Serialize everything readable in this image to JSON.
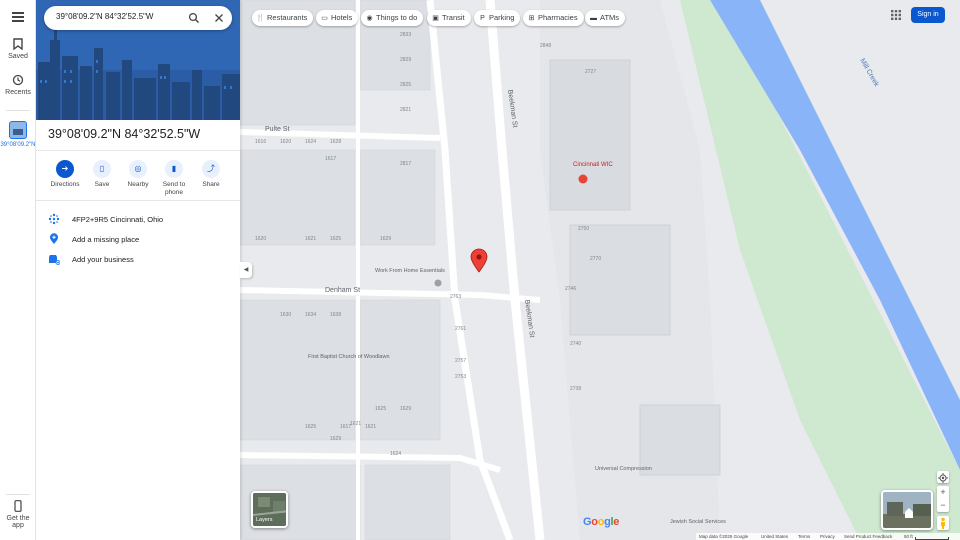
{
  "rail": {
    "saved_label": "Saved",
    "recents_label": "Recents",
    "recent_place_label": "39°08'09.2\"N",
    "get_app_label": "Get the app"
  },
  "search": {
    "value": "39°08'09.2\"N 84°32'52.5\"W"
  },
  "place": {
    "title": "39°08'09.2\"N 84°32'52.5\"W"
  },
  "actions": [
    {
      "label": "Directions",
      "icon": "directions-icon"
    },
    {
      "label": "Save",
      "icon": "bookmark-icon"
    },
    {
      "label": "Nearby",
      "icon": "nearby-icon"
    },
    {
      "label": "Send to phone",
      "icon": "phone-icon"
    },
    {
      "label": "Share",
      "icon": "share-icon"
    }
  ],
  "info": {
    "plus_code": "4FP2+9R5 Cincinnati, Ohio",
    "add_place": "Add a missing place",
    "add_business": "Add your business"
  },
  "chips": [
    {
      "label": "Restaurants",
      "icon": "restaurant-icon"
    },
    {
      "label": "Hotels",
      "icon": "hotel-icon"
    },
    {
      "label": "Things to do",
      "icon": "camera-icon"
    },
    {
      "label": "Transit",
      "icon": "transit-icon"
    },
    {
      "label": "Parking",
      "icon": "parking-icon"
    },
    {
      "label": "Pharmacies",
      "icon": "pharmacy-icon"
    },
    {
      "label": "ATMs",
      "icon": "atm-icon"
    }
  ],
  "header": {
    "signin_label": "Sign in"
  },
  "map": {
    "layers_label": "Layers",
    "streets": {
      "beekman": "Beekman St",
      "pulte": "Pulte St",
      "denham": "Denham St"
    },
    "creek_label": "Mill Creek",
    "pois": {
      "wic": "Cincinnati WIC",
      "work_from_home": "Work From Home Essentials",
      "church": "First Baptist Church of Woodlawn",
      "universal": "Universal Compression"
    },
    "poi_labels_extra": {
      "jewish": "Jewish Social Services"
    },
    "house_numbers": [
      "2833",
      "2829",
      "2825",
      "2821",
      "2817",
      "1620",
      "1616",
      "1624",
      "1628",
      "1621",
      "1625",
      "1629",
      "1620",
      "1617",
      "1621",
      "1624",
      "2763",
      "2761",
      "2757",
      "2753",
      "1630",
      "1634",
      "1638",
      "1625",
      "1629",
      "2750",
      "2746",
      "2740",
      "2738",
      "2727",
      "2770",
      "2849",
      "1617",
      "1621",
      "1625",
      "1629",
      "2848",
      "2857"
    ]
  },
  "footer": {
    "map_data": "Map data ©2025 Google",
    "country": "United States",
    "terms": "Terms",
    "privacy": "Privacy",
    "feedback": "Send Product Feedback",
    "scale": "50 ft"
  },
  "colors": {
    "accent": "#0b57d0",
    "road": "#ffffff",
    "land": "#e8eaed",
    "water": "#8ab4f8",
    "park": "#c8e6c9",
    "pin": "#ea4335"
  }
}
